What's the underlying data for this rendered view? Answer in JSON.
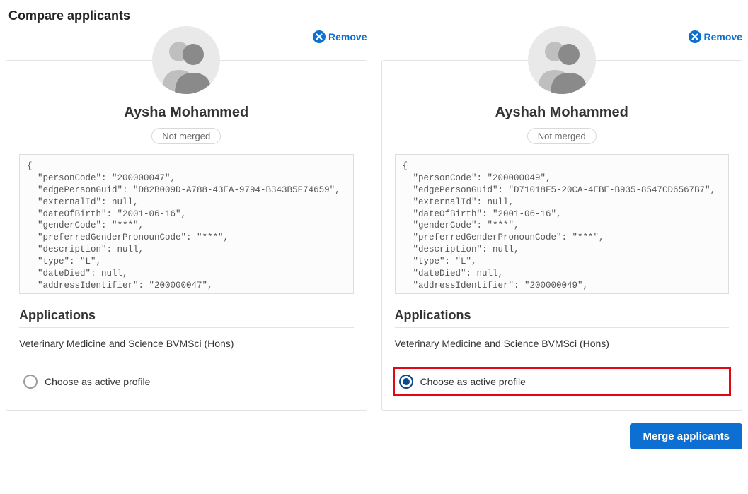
{
  "page": {
    "title": "Compare applicants",
    "removeLabel": "Remove",
    "applicationsHeading": "Applications",
    "chooseLabel": "Choose as active profile",
    "mergeButton": "Merge applicants"
  },
  "applicants": [
    {
      "name": "Aysha Mohammed",
      "mergeStatus": "Not merged",
      "json": "{\n  \"personCode\": \"200000047\",\n  \"edgePersonGuid\": \"D82B009D-A788-43EA-9794-B343B5F74659\",\n  \"externalId\": null,\n  \"dateOfBirth\": \"2001-06-16\",\n  \"genderCode\": \"***\",\n  \"preferredGenderPronounCode\": \"***\",\n  \"description\": null,\n  \"type\": \"L\",\n  \"dateDied\": null,\n  \"addressIdentifier\": \"200000047\",\n  \"externalReference\": null,",
      "application": "Veterinary Medicine and Science BVMSci (Hons)",
      "selected": false
    },
    {
      "name": "Ayshah Mohammed",
      "mergeStatus": "Not merged",
      "json": "{\n  \"personCode\": \"200000049\",\n  \"edgePersonGuid\": \"D71018F5-20CA-4EBE-B935-8547CD6567B7\",\n  \"externalId\": null,\n  \"dateOfBirth\": \"2001-06-16\",\n  \"genderCode\": \"***\",\n  \"preferredGenderPronounCode\": \"***\",\n  \"description\": null,\n  \"type\": \"L\",\n  \"dateDied\": null,\n  \"addressIdentifier\": \"200000049\",\n  \"externalReference\": null,",
      "application": "Veterinary Medicine and Science BVMSci (Hons)",
      "selected": true
    }
  ]
}
